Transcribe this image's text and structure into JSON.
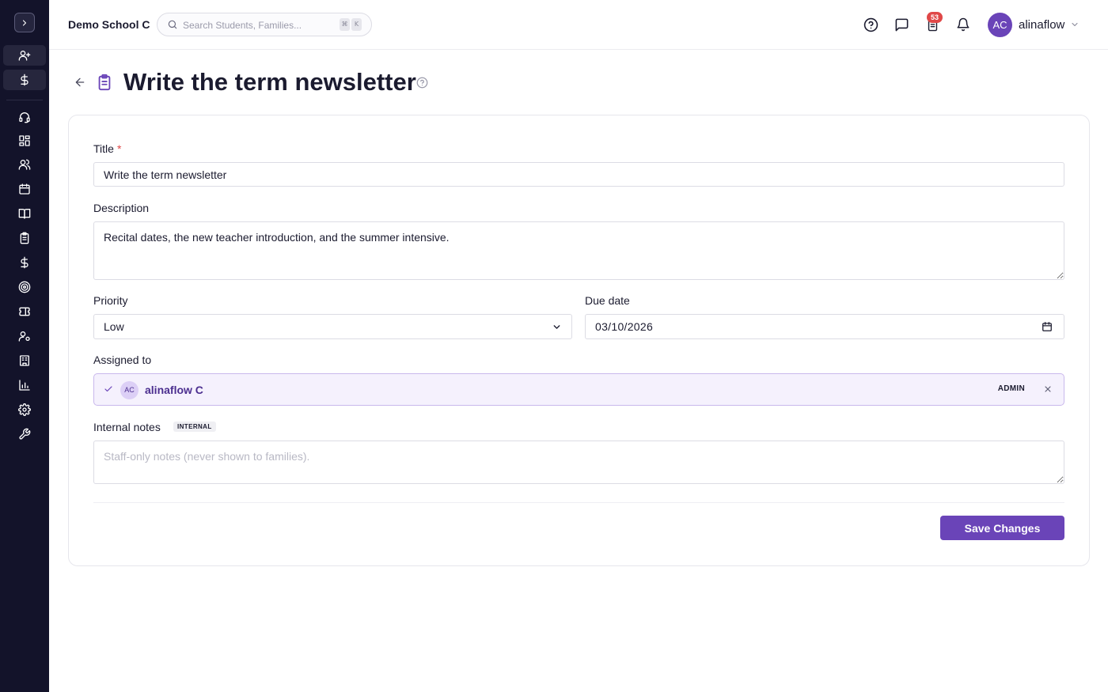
{
  "sidebar": {
    "items": [
      {
        "icon": "user-plus-icon"
      },
      {
        "icon": "dollar-icon"
      },
      {
        "icon": "headset-icon"
      },
      {
        "icon": "dashboard-icon"
      },
      {
        "icon": "users-icon"
      },
      {
        "icon": "calendar-icon"
      },
      {
        "icon": "book-icon"
      },
      {
        "icon": "clipboard-icon"
      },
      {
        "icon": "dollar-icon"
      },
      {
        "icon": "target-icon"
      },
      {
        "icon": "ticket-icon"
      },
      {
        "icon": "user-settings-icon"
      },
      {
        "icon": "building-icon"
      },
      {
        "icon": "bar-chart-icon"
      },
      {
        "icon": "gear-icon"
      },
      {
        "icon": "wrench-icon"
      }
    ]
  },
  "header": {
    "school_name": "Demo School C",
    "search_placeholder": "Search Students, Families...",
    "shortcut_keys": [
      "⌘",
      "K"
    ],
    "notification_count": "53",
    "user": {
      "initials": "AC",
      "name": "alinaflow"
    }
  },
  "page": {
    "title": "Write the term newsletter"
  },
  "form": {
    "title_label": "Title",
    "title_required": "*",
    "title_value": "Write the term newsletter",
    "description_label": "Description",
    "description_value": "Recital dates, the new teacher introduction, and the summer intensive.",
    "priority_label": "Priority",
    "priority_value": "Low",
    "due_date_label": "Due date",
    "due_date_value": "03/10/2026",
    "assigned_label": "Assigned to",
    "assignee": {
      "initials": "AC",
      "name": "alinaflow C",
      "role": "ADMIN"
    },
    "internal_notes_label": "Internal notes",
    "internal_tag": "INTERNAL",
    "internal_notes_placeholder": "Staff-only notes (never shown to families).",
    "save_label": "Save Changes"
  },
  "colors": {
    "sidebar_bg": "#13132a",
    "accent": "#6a44b8",
    "badge": "#e04848"
  }
}
